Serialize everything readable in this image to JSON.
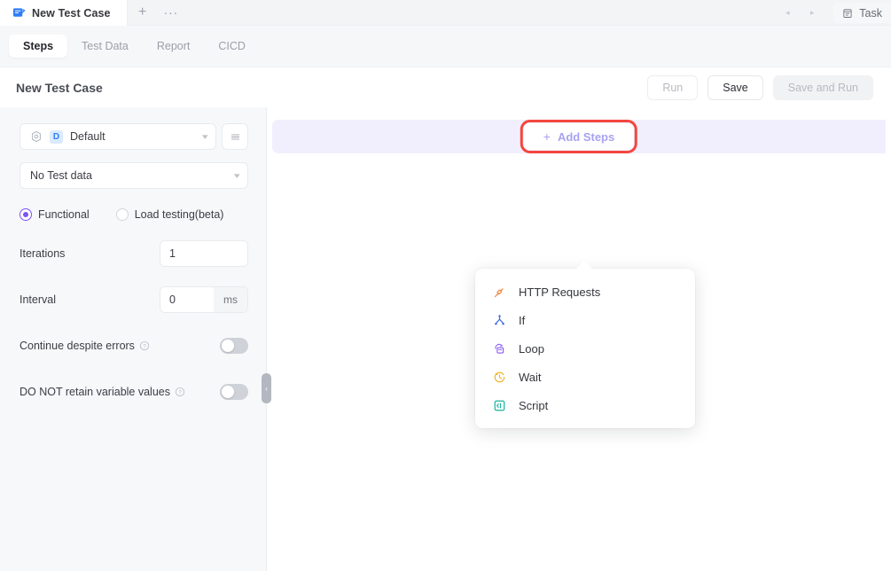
{
  "window": {
    "tab": {
      "title": "New Test Case",
      "icon": "test-case-icon"
    },
    "new_tab_label": "+",
    "more_label": "···",
    "nav_prev": "◂",
    "nav_next": "▸",
    "task_chip": {
      "label": "Task",
      "icon": "calendar-icon"
    }
  },
  "subtabs": [
    {
      "label": "Steps",
      "active": true
    },
    {
      "label": "Test Data",
      "active": false
    },
    {
      "label": "Report",
      "active": false
    },
    {
      "label": "CICD",
      "active": false
    }
  ],
  "header": {
    "page_title": "New Test Case",
    "buttons": {
      "run": "Run",
      "save": "Save",
      "save_and_run": "Save and Run"
    }
  },
  "sidebar": {
    "environment": {
      "badge": "D",
      "value": "Default",
      "settings_icon": "gear-icon",
      "caret_icon": "chevron-down-icon",
      "menu_icon": "hamburger-icon"
    },
    "test_data": {
      "value": "No Test data",
      "caret_icon": "chevron-down-icon"
    },
    "mode": {
      "functional": "Functional",
      "load_testing": "Load testing(beta)",
      "selected": "Functional"
    },
    "iterations": {
      "label": "Iterations",
      "value": "1"
    },
    "interval": {
      "label": "Interval",
      "value": "0",
      "unit": "ms"
    },
    "continue_despite_errors": {
      "label": "Continue despite errors",
      "help": "?",
      "enabled": false
    },
    "do_not_retain": {
      "label": "DO NOT retain variable values",
      "help": "?",
      "enabled": false
    },
    "collapse_handle": "‹"
  },
  "canvas": {
    "add_steps": {
      "label": "Add Steps",
      "plus": "+"
    },
    "highlight_color": "#f4463f",
    "banner_color": "#f1effd",
    "accent_color": "#a8a2f2"
  },
  "step_menu": [
    {
      "label": "HTTP Requests",
      "icon": "http-requests-icon",
      "color": "#f2803c"
    },
    {
      "label": "If",
      "icon": "if-branch-icon",
      "color": "#3e6ae0"
    },
    {
      "label": "Loop",
      "icon": "loop-icon",
      "color": "#8b5cf6"
    },
    {
      "label": "Wait",
      "icon": "wait-clock-icon",
      "color": "#f0b429"
    },
    {
      "label": "Script",
      "icon": "script-icon",
      "color": "#17b39e"
    }
  ]
}
